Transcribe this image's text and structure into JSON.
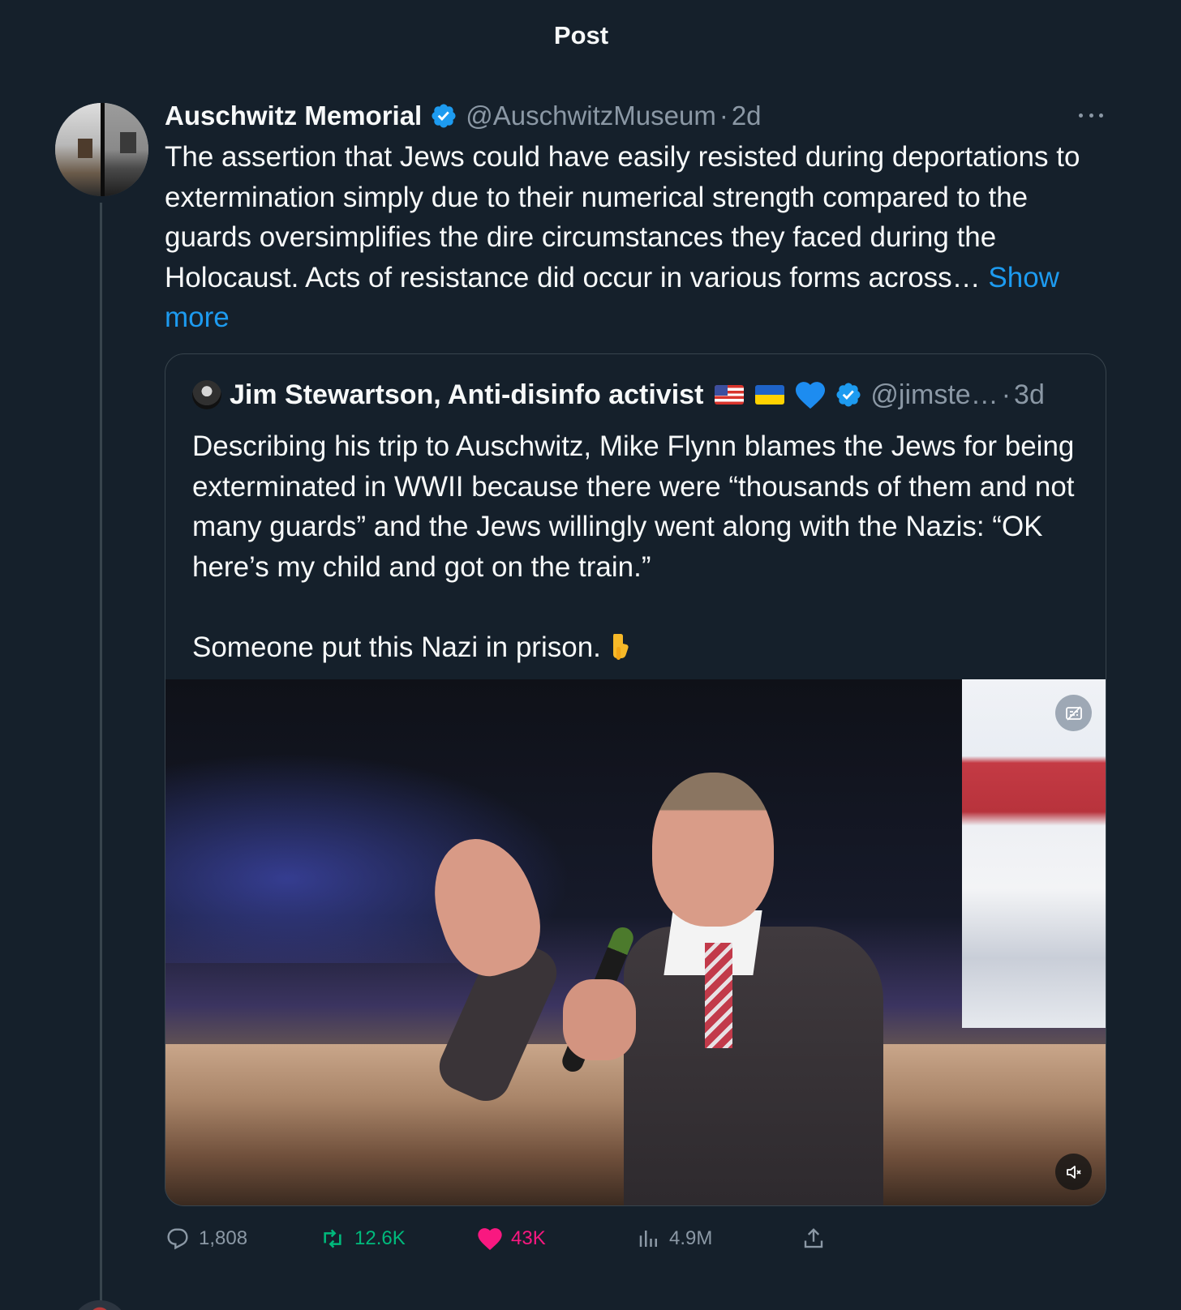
{
  "header": {
    "title": "Post"
  },
  "post": {
    "author_name": "Auschwitz Memorial",
    "handle": "@AuschwitzMuseum",
    "separator": "·",
    "time": "2d",
    "text": "The assertion that Jews could have easily resisted during deportations to extermination simply due to their numerical strength compared to the guards oversimplifies the dire circumstances they faced during the Holocaust. Acts of resistance did occur in various forms across… ",
    "show_more": "Show more"
  },
  "quote": {
    "author_name": "Jim Stewartson, Anti-disinfo activist",
    "handle": "@jimste…",
    "separator": "·",
    "time": "3d",
    "paragraph1": "Describing his trip to Auschwitz, Mike Flynn blames the Jews for being exterminated in WWII because there were “thousands of them and not many guards” and the Jews willingly went along with the Nazis: “OK here’s my child and got on the train.”",
    "paragraph2": "Someone put this Nazi in prison. "
  },
  "actions": {
    "replies": "1,808",
    "reposts": "12.6K",
    "likes": "43K",
    "views": "4.9M"
  },
  "colors": {
    "background": "#15202b",
    "accent": "#1d9bf0",
    "repost_green": "#00ba7c",
    "like_pink": "#f91880",
    "muted": "#8b98a5"
  }
}
